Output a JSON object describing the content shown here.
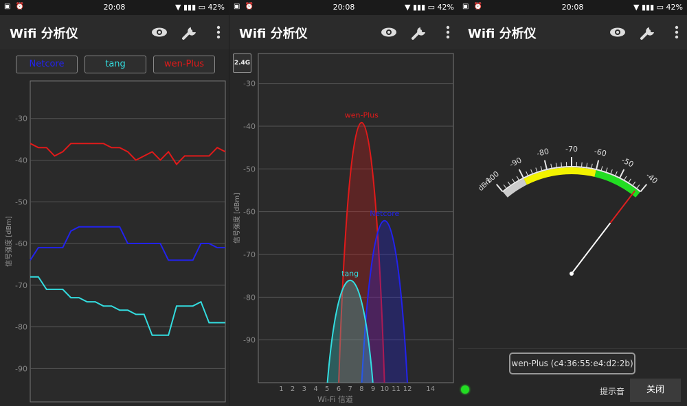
{
  "status_bar": {
    "time": "20:08",
    "battery": "42%"
  },
  "app": {
    "title": "Wifi 分析仪"
  },
  "icons": {
    "eye": "eye-icon",
    "wrench": "wrench-icon",
    "more": "more-vertical-icon"
  },
  "colors": {
    "netcore": "#2222ee",
    "tang": "#33dde0",
    "wen_plus": "#e01a1a"
  },
  "time_graph": {
    "legend": [
      "Netcore",
      "tang",
      "wen-Plus"
    ],
    "ylabel": "信号强度 [dBm]",
    "y_ticks": [
      "-30",
      "-40",
      "-50",
      "-60",
      "-70",
      "-80",
      "-90"
    ]
  },
  "channel_graph": {
    "band_button": "2.4G",
    "xlabel": "Wi-Fi 信道",
    "ylabel": "信号强度 [dBm]",
    "x_ticks": [
      "1",
      "2",
      "3",
      "4",
      "5",
      "6",
      "7",
      "8",
      "9",
      "10",
      "11",
      "12",
      "14"
    ],
    "y_ticks": [
      "-30",
      "-40",
      "-50",
      "-60",
      "-70",
      "-80",
      "-90"
    ]
  },
  "meter": {
    "unit": "dBm",
    "scale_labels": [
      "-100",
      "-90",
      "-80",
      "-70",
      "-60",
      "-50",
      "-40"
    ],
    "bssid_label": "wen-Plus (c4:36:55:e4:d2:2b)",
    "sound_label": "提示音",
    "close_label": "关闭"
  },
  "chart_data": [
    {
      "type": "line",
      "title": "",
      "ylabel": "信号强度 [dBm]",
      "ylim": [
        -98,
        -21
      ],
      "x": [
        0,
        1,
        2,
        3,
        4,
        5,
        6,
        7,
        8,
        9,
        10,
        11,
        12,
        13,
        14,
        15,
        16,
        17,
        18,
        19,
        20,
        21,
        22,
        23,
        24
      ],
      "series": [
        {
          "name": "wen-Plus",
          "values": [
            -36,
            -37,
            -37,
            -39,
            -38,
            -36,
            -36,
            -36,
            -36,
            -36,
            -37,
            -37,
            -38,
            -40,
            -39,
            -38,
            -40,
            -38,
            -41,
            -39,
            -39,
            -39,
            -39,
            -37,
            -38
          ]
        },
        {
          "name": "Netcore",
          "values": [
            -64,
            -61,
            -61,
            -61,
            -61,
            -57,
            -56,
            -56,
            -56,
            -56,
            -56,
            -56,
            -60,
            -60,
            -60,
            -60,
            -60,
            -64,
            -64,
            -64,
            -64,
            -60,
            -60,
            -61,
            -61
          ]
        },
        {
          "name": "tang",
          "values": [
            -68,
            -68,
            -71,
            -71,
            -71,
            -73,
            -73,
            -74,
            -74,
            -75,
            -75,
            -76,
            -76,
            -77,
            -77,
            -82,
            -82,
            -82,
            -75,
            -75,
            -75,
            -74,
            -79,
            -79,
            -79
          ]
        }
      ],
      "grid": true
    },
    {
      "type": "area",
      "xlabel": "Wi-Fi 信道",
      "ylabel": "信号强度 [dBm]",
      "xlim": [
        -1,
        16
      ],
      "ylim": [
        -100,
        -23
      ],
      "series": [
        {
          "name": "wen-Plus",
          "channel": 8,
          "peak": -39
        },
        {
          "name": "Netcore",
          "channel": 10,
          "peak": -62
        },
        {
          "name": "tang",
          "channel": 7,
          "peak": -76
        }
      ],
      "grid": true
    },
    {
      "type": "gauge",
      "unit": "dBm",
      "range": [
        -100,
        -40
      ],
      "zones": [
        {
          "from": -100,
          "to": -90,
          "color": "#cccccc"
        },
        {
          "from": -90,
          "to": -60,
          "color": "#f2f200"
        },
        {
          "from": -60,
          "to": -40,
          "color": "#22dd22"
        }
      ],
      "value": -42
    }
  ]
}
